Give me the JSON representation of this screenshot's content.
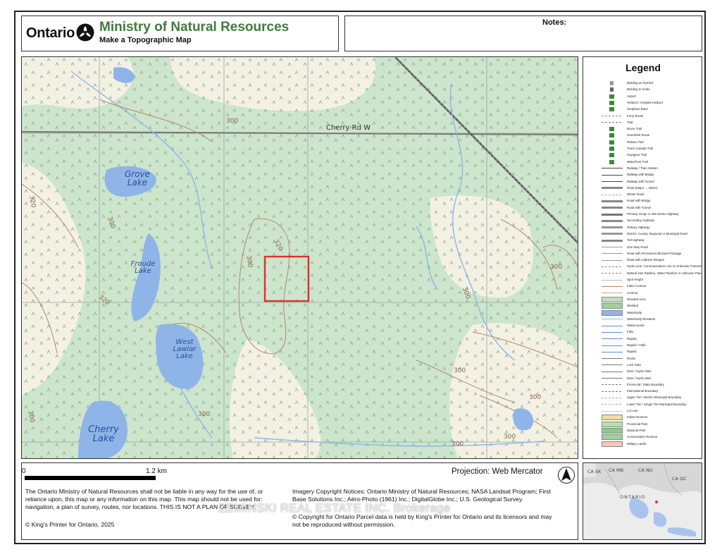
{
  "header": {
    "brand": "Ontario",
    "ministry": "Ministry of Natural Resources",
    "subtitle": "Make a Topographic Map",
    "notes_label": "Notes:"
  },
  "map": {
    "road_label": "Cherry Rd W",
    "lakes": [
      {
        "id": "grove",
        "line1": "Grove",
        "line2": "Lake"
      },
      {
        "id": "froude",
        "line1": "Froude",
        "line2": "Lake"
      },
      {
        "id": "west-lawlar",
        "line1": "West",
        "line2": "Lawlar",
        "line3": "Lake"
      },
      {
        "id": "cherry",
        "line1": "Cherry",
        "line2": "Lake"
      }
    ],
    "contour_labels": [
      "300",
      "320",
      "300",
      "320",
      "300",
      "300",
      "300",
      "320",
      "300",
      "300",
      "300",
      "300",
      "300",
      "300"
    ],
    "colors": {
      "woodland": "#cde5cd",
      "clearing": "#f4f1e4",
      "water": "#8fb4e8",
      "contour": "#b08a6a",
      "highlight": "#e03030"
    }
  },
  "legend": {
    "title": "Legend",
    "items": [
      "Building as Symbol",
      "Building to Scale",
      "Airport",
      "Heliport / Hospital Heliport",
      "Seaplane Base",
      "Ferry Route",
      "Trail",
      "Bruce Trail",
      "Greenbelt Route",
      "Rideau Trail",
      "Trans Canada Trail",
      "Voyageur Trail",
      "Waterfront Trail",
      "Railway / Train Station",
      "Railway with Bridge",
      "Railway with Tunnel",
      "Road (Major → Minor)",
      "Winter Road",
      "Road with Bridge",
      "Road with Tunnel",
      "Primary, Kings or 400 Series Highway",
      "Secondary Highway",
      "Tertiary Highway",
      "District, County, Regional or Municipal Road",
      "Toll Highway",
      "One Way Road",
      "Road with Permanent Blocked Passage",
      "Road with Address Ranges",
      "Hydro Line, Communication Line or Unknown Transmission Line",
      "Natural Gas Pipeline, Water Pipeline or Unknown Pipeline",
      "Spot Height",
      "Index Contour",
      "Contour",
      "Wooded Area",
      "Wetland",
      "Waterbody",
      "Waterbody Elevation",
      "Watercourse",
      "Falls",
      "Rapids",
      "Rapids / Falls",
      "Rapids",
      "Rocks",
      "Lock Gate",
      "Dam / Hydro Weir",
      "Dam / Hydro Weir",
      "Provincial / State Boundary",
      "International Boundary",
      "Upper Tier / District Municipal Boundary",
      "Lower Tier / Single Tier Municipal Boundary",
      "Lot Line",
      "Indian Reserve",
      "Provincial Park",
      "National Park",
      "Conservation Reserve",
      "Military Lands"
    ]
  },
  "footer": {
    "scale_start": "0",
    "scale_end": "1.2  km",
    "projection": "Projection: Web Mercator",
    "disclaimer_1": "The Ontario Ministry of Natural Resources shall not be liable in any way for the use of, or",
    "disclaimer_2": "reliance upon, this map or any information on this map.  This map should not be used for:",
    "disclaimer_3": "navigation, a plan of survey, routes, nor locations. THIS IS NOT A PLAN OF SURVEY.",
    "copyright": "© King's Printer for Ontario,  2025",
    "imagery_1": "Imagery Copyright Notices: Ontario Ministry of Natural Resources; NASA Landsat Program; First",
    "imagery_2": "Base Solutions Inc.; Aéro-Photo (1961) Inc.; DigitalGlobe Inc.; U.S. Geological Survey.",
    "parcel_1": "© Copyright for Ontario Parcel data is held by King's Printer for Ontario and its licensors and may",
    "parcel_2": "not be reproduced without permission.",
    "watermark": "ZEMINSKI REAL ESTATE INC. Brokerage"
  },
  "inset": {
    "labels": [
      "CA SK",
      "CA MB",
      "CA NU",
      "CA QC",
      "ONTARIO"
    ]
  }
}
